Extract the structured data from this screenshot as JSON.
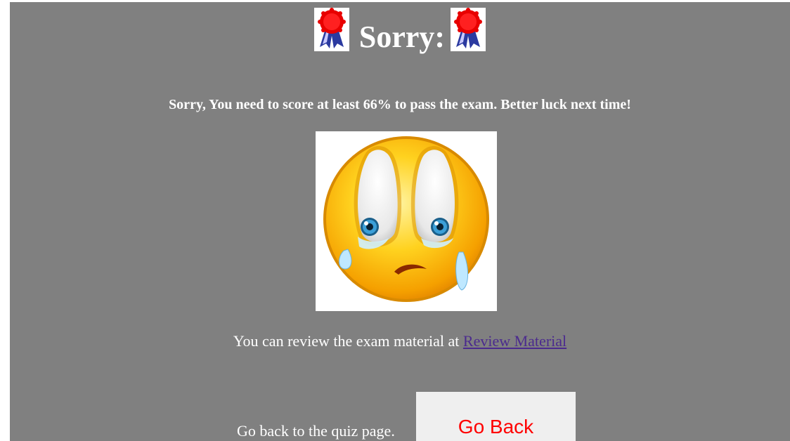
{
  "heading": {
    "title": "Sorry:",
    "ribbon_icon": "award-ribbon-icon"
  },
  "message": "Sorry, You need to score at least 66% to pass the exam. Better luck next time!",
  "image": {
    "icon": "crying-face-emoji"
  },
  "review": {
    "text": "You can review the exam material at",
    "link_label": "Review Material"
  },
  "back": {
    "text": "Go back to the quiz page.",
    "button_label": "Go Back"
  },
  "colors": {
    "background": "#808080",
    "text": "#ffffff",
    "link": "#4b2a8e",
    "button_text": "#ff0000",
    "button_bg": "#efefef"
  }
}
